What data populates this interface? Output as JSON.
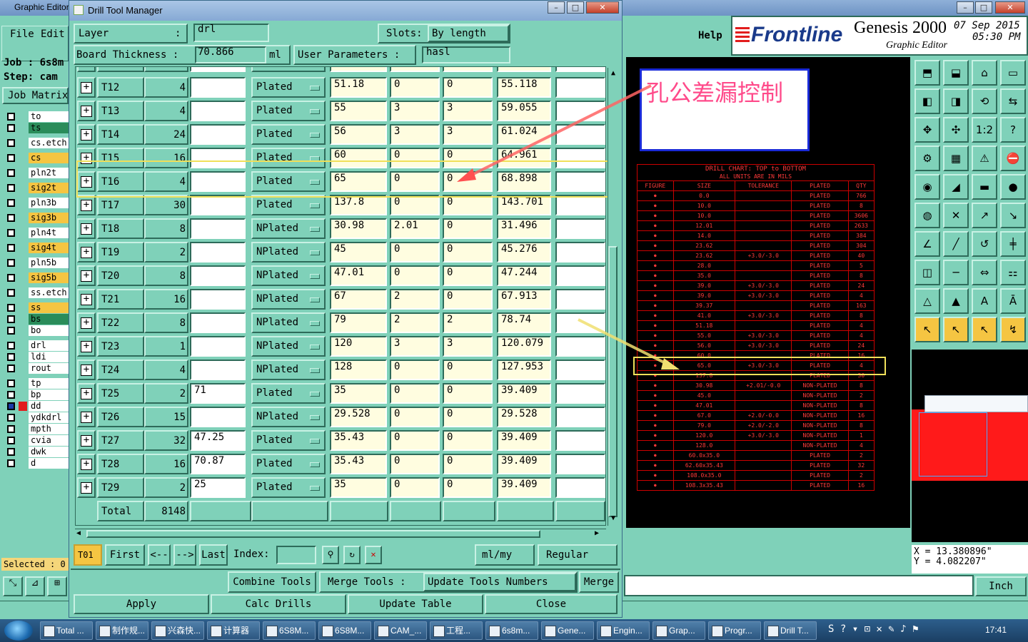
{
  "genesis": {
    "title": "Graphic Editor",
    "menu": {
      "file": "File",
      "edit": "Edit",
      "help": "Help"
    },
    "brand": {
      "logo": "Frontline",
      "product": "Genesis 2000",
      "sub": "Graphic Editor",
      "date": "07 Sep 2015",
      "time": "05:30 PM"
    },
    "job_label": "Job : 6s8m",
    "step_label": "Step: cam",
    "job_matrix": "Job Matrix",
    "selected": "Selected : 0",
    "coords": {
      "x": "X = 13.380896\"",
      "y": "Y = 4.082207\""
    },
    "units": "Inch",
    "layers": [
      {
        "name": "to",
        "color": "#ffffff"
      },
      {
        "name": "ts",
        "color": "#2a8c5a"
      },
      {
        "name": "cs.etch",
        "color": "#ffffff"
      },
      {
        "name": "cs",
        "color": "#f5c542"
      },
      {
        "name": "pln2t",
        "color": "#ffffff"
      },
      {
        "name": "sig2t",
        "color": "#f5c542"
      },
      {
        "name": "pln3b",
        "color": "#ffffff"
      },
      {
        "name": "sig3b",
        "color": "#f5c542"
      },
      {
        "name": "pln4t",
        "color": "#ffffff"
      },
      {
        "name": "sig4t",
        "color": "#f5c542"
      },
      {
        "name": "pln5b",
        "color": "#ffffff"
      },
      {
        "name": "sig5b",
        "color": "#f5c542"
      },
      {
        "name": "ss.etch",
        "color": "#ffffff"
      },
      {
        "name": "ss",
        "color": "#f5c542"
      },
      {
        "name": "bs",
        "color": "#2a8c5a"
      },
      {
        "name": "bo",
        "color": "#ffffff"
      },
      {
        "name": "drl",
        "color": "#ffffff"
      },
      {
        "name": "ldi",
        "color": "#ffffff"
      },
      {
        "name": "rout",
        "color": "#ffffff"
      },
      {
        "name": "tp",
        "color": "#ffffff"
      },
      {
        "name": "bp",
        "color": "#ffffff"
      },
      {
        "name": "dd",
        "color": "#ffffff"
      },
      {
        "name": "ydkdrl",
        "color": "#ffffff"
      },
      {
        "name": "mpth",
        "color": "#ffffff"
      },
      {
        "name": "cvia",
        "color": "#ffffff"
      },
      {
        "name": "dwk",
        "color": "#ffffff"
      },
      {
        "name": "d",
        "color": "#ffffff"
      }
    ]
  },
  "dialog": {
    "title": "Drill Tool Manager",
    "layer_label": "Layer",
    "layer_colon": ":",
    "layer_value": "drl",
    "slots_label": "Slots:",
    "slots_value": "By length",
    "thickness_label": "Board Thickness :",
    "thickness_value": "70.866",
    "thickness_unit": "ml",
    "user_params_label": "User Parameters :",
    "user_params_value": "hasl",
    "rows": [
      {
        "tool": "T12",
        "count": "4",
        "user": "",
        "type": "Plated",
        "finish": "51.18",
        "plus_tol": "0",
        "minus_tol": "0",
        "drill": "55.118"
      },
      {
        "tool": "T13",
        "count": "4",
        "user": "",
        "type": "Plated",
        "finish": "55",
        "plus_tol": "3",
        "minus_tol": "3",
        "drill": "59.055"
      },
      {
        "tool": "T14",
        "count": "24",
        "user": "",
        "type": "Plated",
        "finish": "56",
        "plus_tol": "3",
        "minus_tol": "3",
        "drill": "61.024"
      },
      {
        "tool": "T15",
        "count": "16",
        "user": "",
        "type": "Plated",
        "finish": "60",
        "plus_tol": "0",
        "minus_tol": "0",
        "drill": "64.961"
      },
      {
        "tool": "T16",
        "count": "4",
        "user": "",
        "type": "Plated",
        "finish": "65",
        "plus_tol": "0",
        "minus_tol": "0",
        "drill": "68.898"
      },
      {
        "tool": "T17",
        "count": "30",
        "user": "",
        "type": "Plated",
        "finish": "137.8",
        "plus_tol": "0",
        "minus_tol": "0",
        "drill": "143.701"
      },
      {
        "tool": "T18",
        "count": "8",
        "user": "",
        "type": "NPlated",
        "finish": "30.98",
        "plus_tol": "2.01",
        "minus_tol": "0",
        "drill": "31.496"
      },
      {
        "tool": "T19",
        "count": "2",
        "user": "",
        "type": "NPlated",
        "finish": "45",
        "plus_tol": "0",
        "minus_tol": "0",
        "drill": "45.276"
      },
      {
        "tool": "T20",
        "count": "8",
        "user": "",
        "type": "NPlated",
        "finish": "47.01",
        "plus_tol": "0",
        "minus_tol": "0",
        "drill": "47.244"
      },
      {
        "tool": "T21",
        "count": "16",
        "user": "",
        "type": "NPlated",
        "finish": "67",
        "plus_tol": "2",
        "minus_tol": "0",
        "drill": "67.913"
      },
      {
        "tool": "T22",
        "count": "8",
        "user": "",
        "type": "NPlated",
        "finish": "79",
        "plus_tol": "2",
        "minus_tol": "2",
        "drill": "78.74"
      },
      {
        "tool": "T23",
        "count": "1",
        "user": "",
        "type": "NPlated",
        "finish": "120",
        "plus_tol": "3",
        "minus_tol": "3",
        "drill": "120.079"
      },
      {
        "tool": "T24",
        "count": "4",
        "user": "",
        "type": "NPlated",
        "finish": "128",
        "plus_tol": "0",
        "minus_tol": "0",
        "drill": "127.953"
      },
      {
        "tool": "T25",
        "count": "2",
        "user": "71",
        "type": "Plated",
        "finish": "35",
        "plus_tol": "0",
        "minus_tol": "0",
        "drill": "39.409"
      },
      {
        "tool": "T26",
        "count": "15",
        "user": "",
        "type": "NPlated",
        "finish": "29.528",
        "plus_tol": "0",
        "minus_tol": "0",
        "drill": "29.528"
      },
      {
        "tool": "T27",
        "count": "32",
        "user": "47.25",
        "type": "Plated",
        "finish": "35.43",
        "plus_tol": "0",
        "minus_tol": "0",
        "drill": "39.409"
      },
      {
        "tool": "T28",
        "count": "16",
        "user": "70.87",
        "type": "Plated",
        "finish": "35.43",
        "plus_tol": "0",
        "minus_tol": "0",
        "drill": "39.409"
      },
      {
        "tool": "T29",
        "count": "2",
        "user": "25",
        "type": "Plated",
        "finish": "35",
        "plus_tol": "0",
        "minus_tol": "0",
        "drill": "39.409"
      }
    ],
    "total_label": "Total",
    "total_value": "8148",
    "current_tool": "T01",
    "nav": {
      "first": "First",
      "prev": "<--",
      "next": "-->",
      "last": "Last",
      "index": "Index:"
    },
    "units_value": "ml/my",
    "mode_value": "Regular",
    "combine": "Combine Tools",
    "merge_label": "Merge Tools :",
    "merge_value": "Update Tools Numbers",
    "merge_btn": "Merge",
    "apply": "Apply",
    "calc": "Calc Drills",
    "update": "Update Table",
    "close": "Close"
  },
  "annotation": {
    "text": "孔公差漏控制"
  },
  "drill_chart": {
    "title": "DRILL CHART: TOP to BOTTOM",
    "subtitle": "ALL UNITS ARE IN MILS",
    "headers": [
      "FIGURE",
      "SIZE",
      "TOLERANCE",
      "PLATED",
      "QTY"
    ],
    "rows": [
      [
        "0.0",
        "",
        "PLATED",
        "766"
      ],
      [
        "10.0",
        "",
        "PLATED",
        "8"
      ],
      [
        "10.0",
        "",
        "PLATED",
        "3606"
      ],
      [
        "12.01",
        "",
        "PLATED",
        "2633"
      ],
      [
        "14.0",
        "",
        "PLATED",
        "384"
      ],
      [
        "23.62",
        "",
        "PLATED",
        "304"
      ],
      [
        "23.62",
        "+3.0/-3.0",
        "PLATED",
        "40"
      ],
      [
        "28.0",
        "",
        "PLATED",
        "5"
      ],
      [
        "35.0",
        "",
        "PLATED",
        "8"
      ],
      [
        "39.0",
        "+3.0/-3.0",
        "PLATED",
        "24"
      ],
      [
        "39.0",
        "+3.0/-3.0",
        "PLATED",
        "4"
      ],
      [
        "39.37",
        "",
        "PLATED",
        "163"
      ],
      [
        "41.0",
        "+3.0/-3.0",
        "PLATED",
        "8"
      ],
      [
        "51.18",
        "",
        "PLATED",
        "4"
      ],
      [
        "55.0",
        "+3.0/-3.0",
        "PLATED",
        "4"
      ],
      [
        "56.0",
        "+3.0/-3.0",
        "PLATED",
        "24"
      ],
      [
        "60.0",
        "",
        "PLATED",
        "16"
      ],
      [
        "65.0",
        "+3.0/-3.0",
        "PLATED",
        "4"
      ],
      [
        "137.8",
        "",
        "PLATED",
        "30"
      ],
      [
        "30.98",
        "+2.01/-0.0",
        "NON-PLATED",
        "8"
      ],
      [
        "45.0",
        "",
        "NON-PLATED",
        "2"
      ],
      [
        "47.01",
        "",
        "NON-PLATED",
        "8"
      ],
      [
        "67.0",
        "+2.0/-0.0",
        "NON-PLATED",
        "16"
      ],
      [
        "79.0",
        "+2.0/-2.0",
        "NON-PLATED",
        "8"
      ],
      [
        "120.0",
        "+3.0/-3.0",
        "NON-PLATED",
        "1"
      ],
      [
        "128.0",
        "",
        "NON-PLATED",
        "4"
      ],
      [
        "60.0x35.0",
        "",
        "PLATED",
        "2"
      ],
      [
        "62.60x35.43",
        "",
        "PLATED",
        "32"
      ],
      [
        "108.0x35.0",
        "",
        "PLATED",
        "2"
      ],
      [
        "108.3x35.43",
        "",
        "PLATED",
        "16"
      ]
    ]
  },
  "taskbar": {
    "items": [
      "Total ...",
      "制作规...",
      "兴森快...",
      "计算器",
      "6S8M...",
      "6S8M...",
      "CAM_...",
      "工程...",
      "6s8m...",
      "Gene...",
      "Engin...",
      "Grap...",
      "Progr...",
      "Drill T..."
    ],
    "clock": "17:41"
  }
}
